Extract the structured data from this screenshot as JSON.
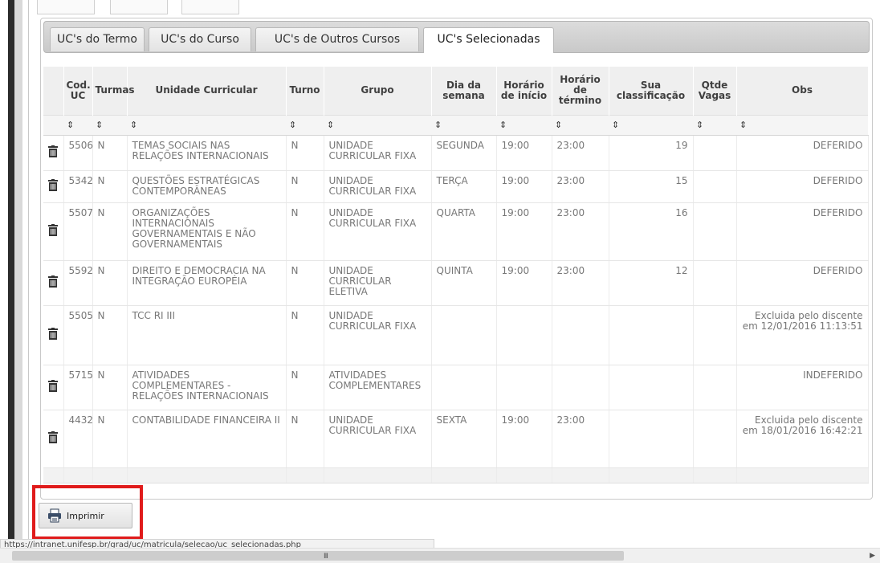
{
  "tabs": [
    {
      "label": "UC's do Termo",
      "active": false
    },
    {
      "label": "UC's do Curso",
      "active": false
    },
    {
      "label": "UC's de Outros Cursos",
      "active": false
    },
    {
      "label": "UC's Selecionadas",
      "active": true
    }
  ],
  "table": {
    "headers": {
      "cod_uc": "Cod. UC",
      "turmas": "Turmas",
      "unidade": "Unidade Curricular",
      "turno": "Turno",
      "grupo": "Grupo",
      "dia": "Dia da semana",
      "inicio": "Horário de início",
      "termino": "Horário de término",
      "classificacao": "Sua classificação",
      "vagas": "Qtde Vagas",
      "obs": "Obs"
    },
    "sort_icon": "⇕",
    "rows": [
      {
        "cod": "5506",
        "turmas": "N",
        "unidade": "TEMAS SOCIAIS NAS RELAÇÕES INTERNACIONAIS",
        "turno": "N",
        "grupo": "UNIDADE CURRICULAR FIXA",
        "dia": "SEGUNDA",
        "inicio": "19:00",
        "termino": "23:00",
        "classificacao": "19",
        "vagas": "",
        "obs": "DEFERIDO",
        "obs_status": "ok"
      },
      {
        "cod": "5342",
        "turmas": "N",
        "unidade": "QUESTÕES ESTRATÉGICAS CONTEMPORÂNEAS",
        "turno": "N",
        "grupo": "UNIDADE CURRICULAR FIXA",
        "dia": "TERÇA",
        "inicio": "19:00",
        "termino": "23:00",
        "classificacao": "15",
        "vagas": "",
        "obs": "DEFERIDO",
        "obs_status": "ok"
      },
      {
        "cod": "5507",
        "turmas": "N",
        "unidade": "ORGANIZAÇÕES INTERNACIONAIS GOVERNAMENTAIS E NÃO GOVERNAMENTAIS",
        "turno": "N",
        "grupo": "UNIDADE CURRICULAR FIXA",
        "dia": "QUARTA",
        "inicio": "19:00",
        "termino": "23:00",
        "classificacao": "16",
        "vagas": "",
        "obs": "DEFERIDO",
        "obs_status": "ok"
      },
      {
        "cod": "5592",
        "turmas": "N",
        "unidade": "DIREITO E DEMOCRACIA NA INTEGRAÇÃO EUROPÉIA",
        "turno": "N",
        "grupo": "UNIDADE CURRICULAR ELETIVA",
        "dia": "QUINTA",
        "inicio": "19:00",
        "termino": "23:00",
        "classificacao": "12",
        "vagas": "",
        "obs": "DEFERIDO",
        "obs_status": "ok"
      },
      {
        "cod": "5505",
        "turmas": "N",
        "unidade": "TCC RI III",
        "turno": "N",
        "grupo": "UNIDADE CURRICULAR FIXA",
        "dia": "",
        "inicio": "",
        "termino": "",
        "classificacao": "",
        "vagas": "",
        "obs": "Excluida pelo discente em 12/01/2016 11:13:51",
        "obs_status": "note"
      },
      {
        "cod": "5715",
        "turmas": "N",
        "unidade": "ATIVIDADES COMPLEMENTARES - RELAÇÕES INTERNACIONAIS",
        "turno": "N",
        "grupo": "ATIVIDADES COMPLEMENTARES",
        "dia": "",
        "inicio": "",
        "termino": "",
        "classificacao": "",
        "vagas": "",
        "obs": "INDEFERIDO",
        "obs_status": "ok"
      },
      {
        "cod": "4432",
        "turmas": "N",
        "unidade": "CONTABILIDADE FINANCEIRA II",
        "turno": "N",
        "grupo": "UNIDADE CURRICULAR FIXA",
        "dia": "SEXTA",
        "inicio": "19:00",
        "termino": "23:00",
        "classificacao": "",
        "vagas": "",
        "obs": "Excluida pelo discente em 18/01/2016 16:42:21",
        "obs_status": "note"
      }
    ]
  },
  "print_button": {
    "label": "Imprimir",
    "icon": "printer-icon"
  },
  "status_bar": {
    "url": "https://intranet.unifesp.br/grad/uc/matricula/selecao/uc_selecionadas.php"
  },
  "scrollbar": {
    "grip": "III"
  },
  "colors": {
    "status_ok": "#0f7a2b",
    "highlight": "#e01b1b",
    "tab_bar": "#c9c9c9"
  }
}
